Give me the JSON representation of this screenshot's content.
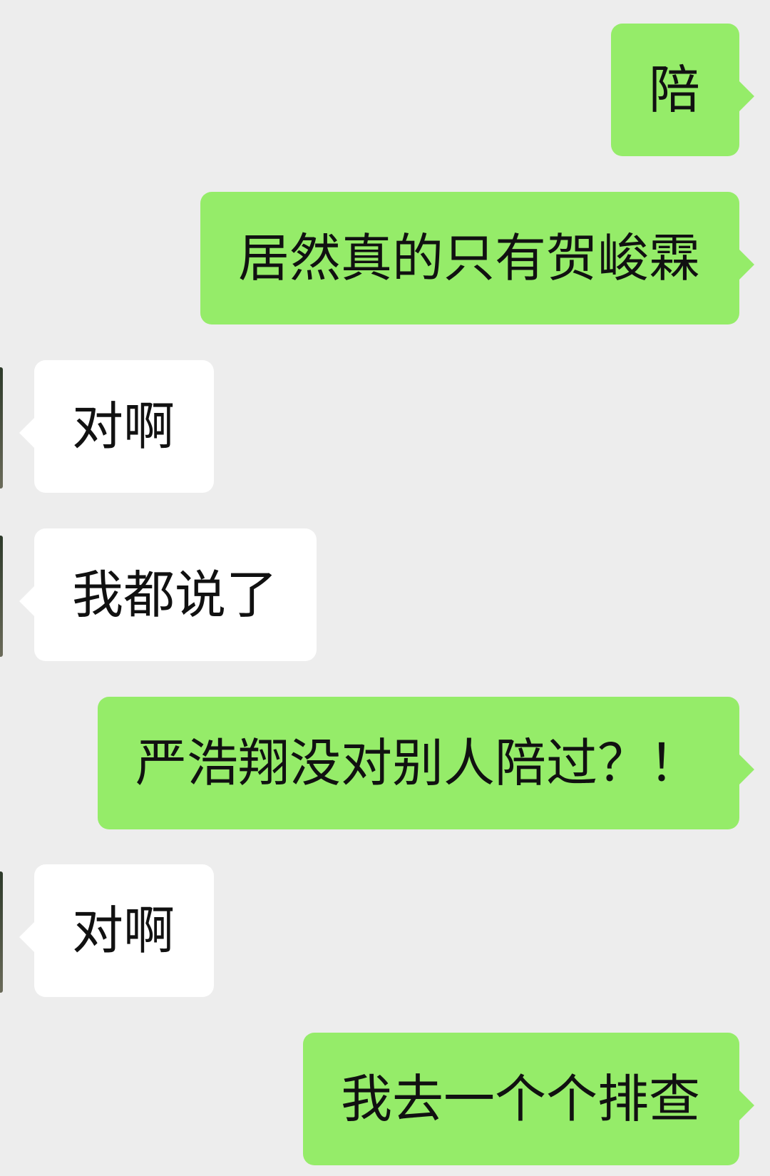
{
  "messages": [
    {
      "sender": "me",
      "text": "陪"
    },
    {
      "sender": "me",
      "text": "居然真的只有贺峻霖"
    },
    {
      "sender": "them",
      "text": "对啊"
    },
    {
      "sender": "them",
      "text": "我都说了"
    },
    {
      "sender": "me",
      "text": "严浩翔没对别人陪过？！"
    },
    {
      "sender": "them",
      "text": "对啊"
    },
    {
      "sender": "me",
      "text": "我去一个个排查"
    }
  ],
  "colors": {
    "background": "#ededed",
    "me_bubble": "#95ec69",
    "them_bubble": "#ffffff",
    "text": "#111111"
  }
}
